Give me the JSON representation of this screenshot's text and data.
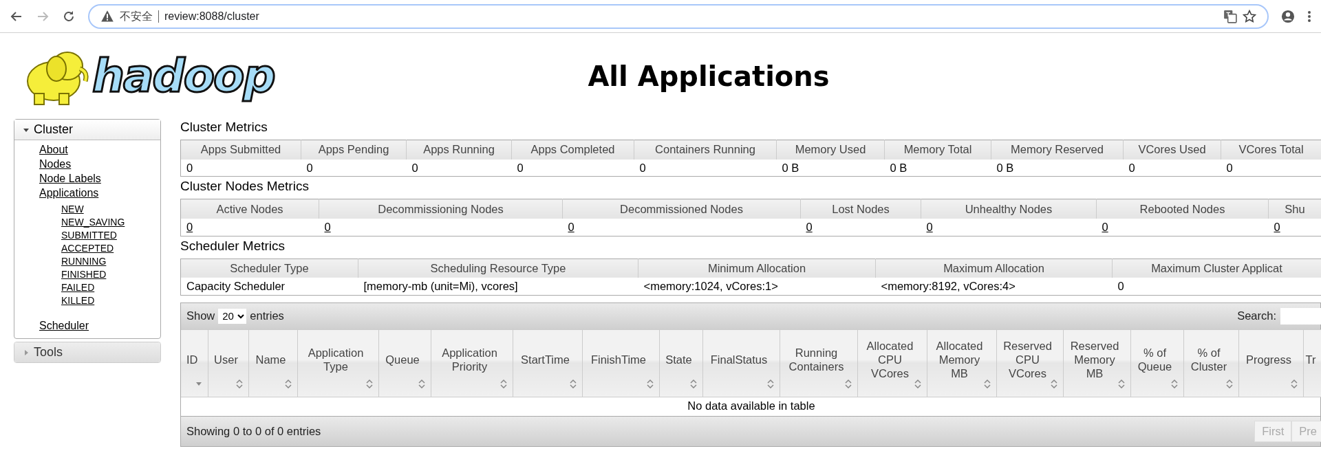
{
  "browser": {
    "back_disabled": false,
    "forward_disabled": true,
    "security_label": "不安全",
    "url": "review:8088/cluster"
  },
  "page": {
    "logo_text": "hadoop",
    "title": "All Applications"
  },
  "sidebar": [
    {
      "label": "Cluster",
      "expanded": true,
      "items": [
        {
          "label": "About"
        },
        {
          "label": "Nodes"
        },
        {
          "label": "Node Labels"
        },
        {
          "label": "Applications",
          "children": [
            {
              "label": "NEW"
            },
            {
              "label": "NEW_SAVING"
            },
            {
              "label": "SUBMITTED"
            },
            {
              "label": "ACCEPTED"
            },
            {
              "label": "RUNNING"
            },
            {
              "label": "FINISHED"
            },
            {
              "label": "FAILED"
            },
            {
              "label": "KILLED"
            }
          ]
        },
        {
          "label": "Scheduler"
        }
      ]
    },
    {
      "label": "Tools",
      "expanded": false
    }
  ],
  "metrics": [
    {
      "title": "Cluster Metrics",
      "links": false,
      "columns": [
        "Apps Submitted",
        "Apps Pending",
        "Apps Running",
        "Apps Completed",
        "Containers Running",
        "Memory Used",
        "Memory Total",
        "Memory Reserved",
        "VCores Used",
        "VCores Total"
      ],
      "values": [
        "0",
        "0",
        "0",
        "0",
        "0",
        "0 B",
        "0 B",
        "0 B",
        "0",
        "0"
      ]
    },
    {
      "title": "Cluster Nodes Metrics",
      "links": true,
      "columns": [
        "Active Nodes",
        "Decommissioning Nodes",
        "Decommissioned Nodes",
        "Lost Nodes",
        "Unhealthy Nodes",
        "Rebooted Nodes",
        "Shu"
      ],
      "values": [
        "0",
        "0",
        "0",
        "0",
        "0",
        "0",
        "0"
      ]
    },
    {
      "title": "Scheduler Metrics",
      "links": false,
      "columns": [
        "Scheduler Type",
        "Scheduling Resource Type",
        "Minimum Allocation",
        "Maximum Allocation",
        "Maximum Cluster Applicat"
      ],
      "values": [
        "Capacity Scheduler",
        "[memory-mb (unit=Mi), vcores]",
        "<memory:1024, vCores:1>",
        "<memory:8192, vCores:4>",
        "0"
      ]
    }
  ],
  "datatable": {
    "show_label": "Show",
    "length": "20",
    "entries_label": "entries",
    "search_label": "Search:",
    "columns": [
      {
        "label": "ID",
        "sortable": true,
        "sorted": true
      },
      {
        "label": "User",
        "sortable": true,
        "sorted": false
      },
      {
        "label": "Name",
        "sortable": true,
        "sorted": false
      },
      {
        "label": "Application Type",
        "sortable": true,
        "sorted": false
      },
      {
        "label": "Queue",
        "sortable": true,
        "sorted": false
      },
      {
        "label": "Application Priority",
        "sortable": true,
        "sorted": false
      },
      {
        "label": "StartTime",
        "sortable": true,
        "sorted": false
      },
      {
        "label": "FinishTime",
        "sortable": true,
        "sorted": false
      },
      {
        "label": "State",
        "sortable": true,
        "sorted": false
      },
      {
        "label": "FinalStatus",
        "sortable": true,
        "sorted": false
      },
      {
        "label": "Running Containers",
        "sortable": true,
        "sorted": false
      },
      {
        "label": "Allocated CPU VCores",
        "sortable": true,
        "sorted": false
      },
      {
        "label": "Allocated Memory MB",
        "sortable": true,
        "sorted": false
      },
      {
        "label": "Reserved CPU VCores",
        "sortable": true,
        "sorted": false
      },
      {
        "label": "Reserved Memory MB",
        "sortable": true,
        "sorted": false
      },
      {
        "label": "% of Queue",
        "sortable": true,
        "sorted": false
      },
      {
        "label": "% of Cluster",
        "sortable": true,
        "sorted": false
      },
      {
        "label": "Progress",
        "sortable": true,
        "sorted": false
      },
      {
        "label": "Tr"
      }
    ],
    "empty_message": "No data available in table",
    "info": "Showing 0 to 0 of 0 entries",
    "pager": [
      {
        "label": "First",
        "disabled": true
      },
      {
        "label": "Pre",
        "disabled": true
      }
    ]
  }
}
